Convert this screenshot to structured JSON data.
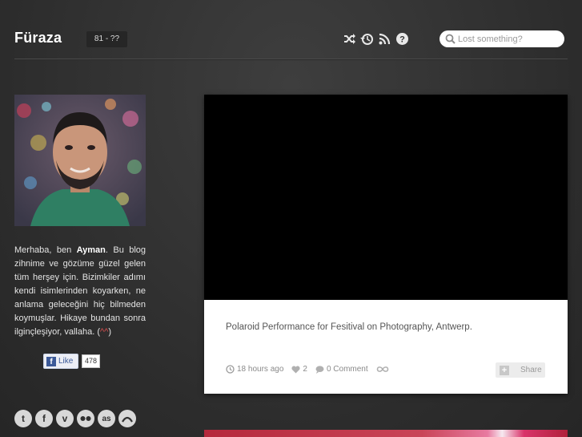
{
  "header": {
    "logo": "Füraza",
    "page_range": "81 - ??",
    "icons": [
      "shuffle-icon",
      "history-icon",
      "rss-icon",
      "help-icon"
    ],
    "search": {
      "placeholder": "Lost something?"
    }
  },
  "sidebar": {
    "bio": {
      "part1": "Merhaba, ben ",
      "name": "Ayman",
      "part2": ". Bu blog zihnime ve gözüme güzel gelen tüm herşey için. Bizimkiler adımı kendi isimlerinden koyarken, ne anlama geleceğini hiç bilmeden koymuşlar. Hikaye bundan sonra ilginçleşiyor, vallaha. (",
      "smile": "^^",
      "part3": ")"
    },
    "facebook": {
      "like_label": "Like",
      "count": "478"
    },
    "social_icons": [
      "twitter-icon",
      "facebook-icon",
      "vimeo-icon",
      "flickr-icon",
      "lastfm-icon",
      "dribbble-icon"
    ]
  },
  "post": {
    "caption": "Polaroid Performance for Fesitival on Photography, Antwerp.",
    "time": "18 hours ago",
    "likes": "2",
    "comments": "0 Comment",
    "share_label": "Share"
  },
  "colors": {
    "background": "#323232",
    "card": "#ffffff",
    "video": "#000000"
  }
}
